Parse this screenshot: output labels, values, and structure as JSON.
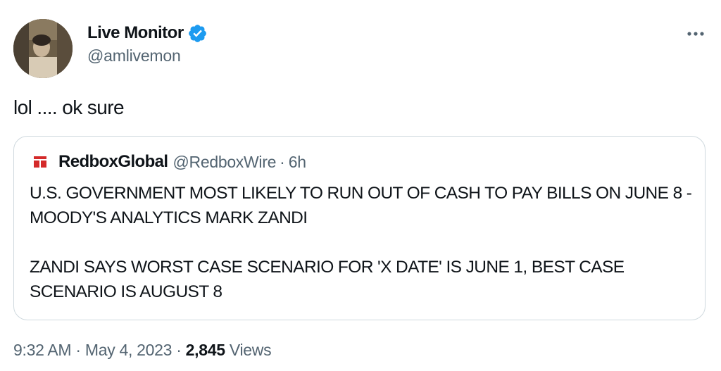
{
  "author": {
    "display_name": "Live Monitor",
    "handle": "@amlivemon",
    "verified_icon": "verified-badge-icon",
    "accent_color": "#1d9bf0"
  },
  "tweet": {
    "text": "lol .... ok sure"
  },
  "more_icon": "more-horizontal-icon",
  "quoted": {
    "display_name": "RedboxGlobal",
    "handle": "@RedboxWire",
    "separator": "·",
    "time": "6h",
    "avatar_icon": "redbox-logo-icon",
    "avatar_color": "#d42a2a",
    "paragraphs": [
      "U.S. GOVERNMENT MOST LIKELY TO RUN OUT OF CASH TO PAY BILLS ON JUNE 8 - MOODY'S ANALYTICS MARK ZANDI",
      "ZANDI SAYS WORST CASE SCENARIO FOR 'X DATE' IS JUNE 1, BEST CASE SCENARIO IS AUGUST 8"
    ]
  },
  "meta": {
    "time": "9:32 AM",
    "date": "May 4, 2023",
    "separator": "·",
    "views_count": "2,845",
    "views_label": "Views"
  }
}
